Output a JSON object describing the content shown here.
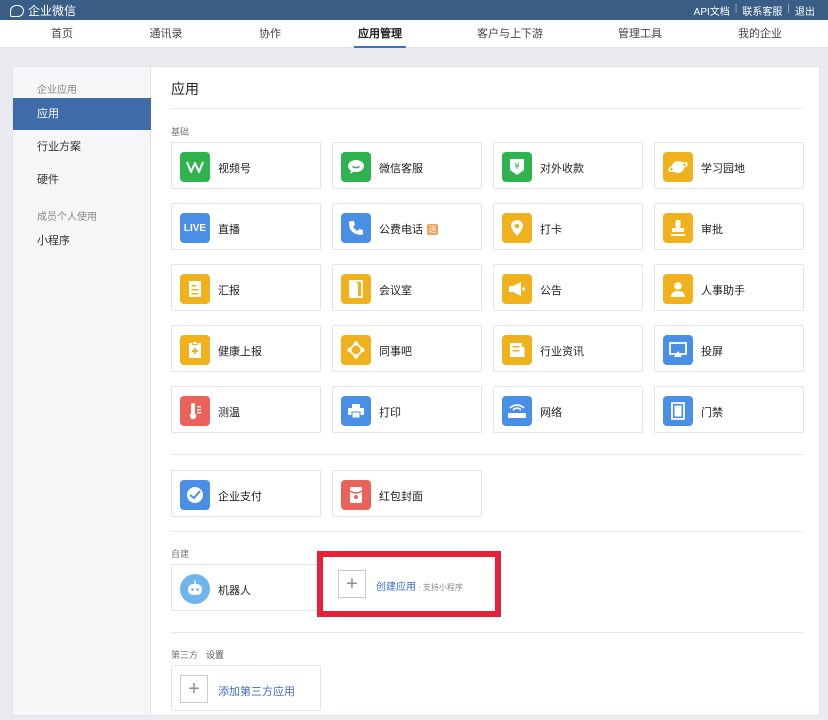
{
  "topbar": {
    "logo_text": "企业微信",
    "links": [
      "API文档",
      "联系客服",
      "退出"
    ]
  },
  "nav": {
    "tabs": [
      "首页",
      "通讯录",
      "协作",
      "应用管理",
      "客户与上下游",
      "管理工具",
      "我的企业"
    ],
    "active_tab": "应用管理"
  },
  "sidebar": {
    "group1": "企业应用",
    "items1": [
      "应用",
      "行业方案",
      "硬件"
    ],
    "group2": "成员个人使用",
    "items2": [
      "小程序"
    ],
    "active_item": "应用"
  },
  "main": {
    "title": "应用",
    "basic_label": "基础",
    "basic_apps": [
      {
        "label": "视频号",
        "icon": "video-channel-icon",
        "color": "#2fb34e"
      },
      {
        "label": "微信客服",
        "icon": "wechat-service-icon",
        "color": "#2fb34e"
      },
      {
        "label": "对外收款",
        "icon": "payment-collect-icon",
        "color": "#2fb34e"
      },
      {
        "label": "学习园地",
        "icon": "planet-icon",
        "color": "#f0b21c"
      },
      {
        "label": "直播",
        "icon": "live-icon",
        "color": "#4a8fe6"
      },
      {
        "label": "公费电话",
        "icon": "phone-icon",
        "color": "#4a8fe6",
        "tag": "送"
      },
      {
        "label": "打卡",
        "icon": "location-pin-icon",
        "color": "#f0b21c"
      },
      {
        "label": "审批",
        "icon": "stamp-icon",
        "color": "#f0b21c"
      },
      {
        "label": "汇报",
        "icon": "report-icon",
        "color": "#f0b21c"
      },
      {
        "label": "会议室",
        "icon": "door-icon",
        "color": "#f0b21c"
      },
      {
        "label": "公告",
        "icon": "megaphone-icon",
        "color": "#f0b21c"
      },
      {
        "label": "人事助手",
        "icon": "person-icon",
        "color": "#f0b21c"
      },
      {
        "label": "健康上报",
        "icon": "health-clipboard-icon",
        "color": "#f0b21c"
      },
      {
        "label": "同事吧",
        "icon": "network-icon",
        "color": "#f0b21c"
      },
      {
        "label": "行业资讯",
        "icon": "news-icon",
        "color": "#f0b21c"
      },
      {
        "label": "投屏",
        "icon": "screen-cast-icon",
        "color": "#4a8fe6"
      },
      {
        "label": "测温",
        "icon": "thermometer-icon",
        "color": "#e9635a"
      },
      {
        "label": "打印",
        "icon": "printer-icon",
        "color": "#4a8fe6"
      },
      {
        "label": "网络",
        "icon": "router-icon",
        "color": "#4a8fe6"
      },
      {
        "label": "门禁",
        "icon": "access-door-icon",
        "color": "#4a8fe6"
      }
    ],
    "extra_apps": [
      {
        "label": "企业支付",
        "icon": "enterprise-pay-icon",
        "color": "#4a8fe6"
      },
      {
        "label": "红包封面",
        "icon": "red-packet-icon",
        "color": "#e9635a"
      }
    ],
    "custom_label": "自建",
    "robot": {
      "label": "机器人",
      "icon": "robot-icon",
      "color": "#6fb4ea"
    },
    "create": {
      "label": "创建应用",
      "sub": "· 支持小程序"
    },
    "third_party_label": "第三方",
    "settings_label": "设置",
    "add_third_party": "添加第三方应用"
  }
}
